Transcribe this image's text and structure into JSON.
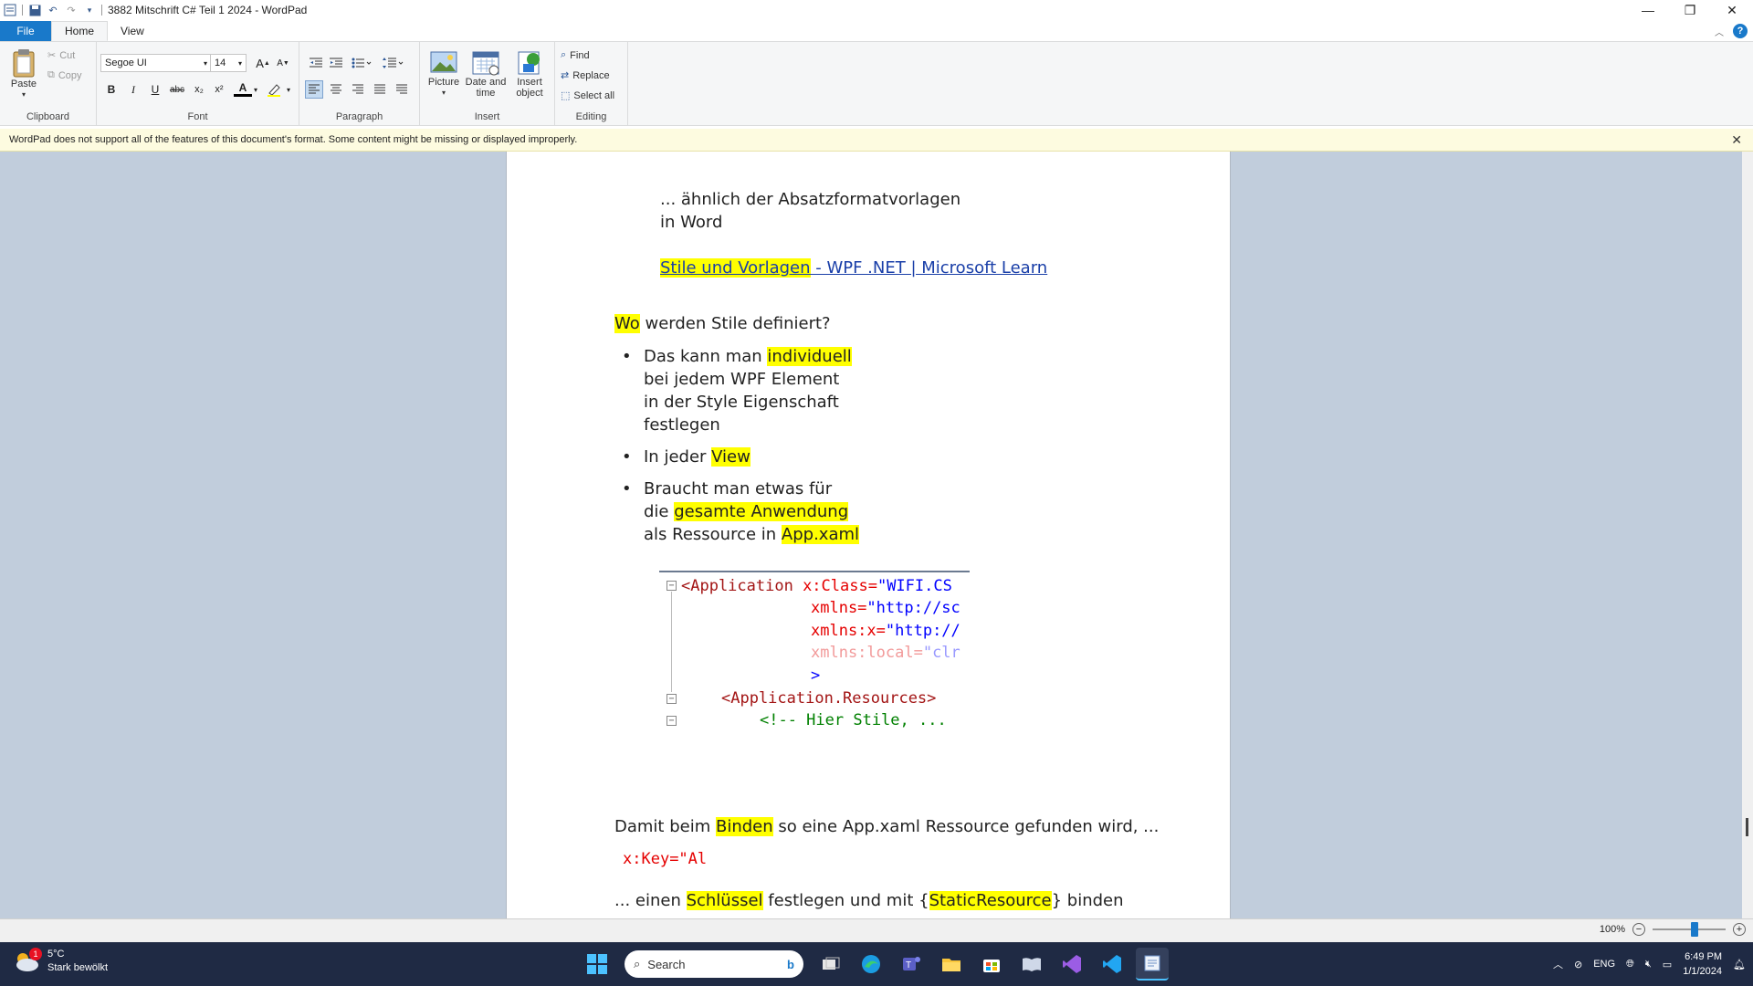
{
  "window": {
    "title": "3882 Mitschrift C# Teil 1 2024 - WordPad"
  },
  "tabs": [
    {
      "label": "File"
    },
    {
      "label": "Home"
    },
    {
      "label": "View"
    }
  ],
  "ribbon": {
    "clipboard": {
      "label": "Clipboard",
      "paste": "Paste",
      "cut": "Cut",
      "copy": "Copy"
    },
    "font": {
      "label": "Font",
      "family": "Segoe UI",
      "size": "14",
      "bold": "B",
      "italic": "I",
      "underline": "U",
      "strike": "abc",
      "subscript": "x₂",
      "superscript": "x²",
      "color_letter": "A",
      "grow": "A",
      "shrink": "A"
    },
    "paragraph": {
      "label": "Paragraph"
    },
    "insert": {
      "label": "Insert",
      "picture": "Picture",
      "datetime_line1": "Date and",
      "datetime_line2": "time",
      "object_line1": "Insert",
      "object_line2": "object"
    },
    "editing": {
      "label": "Editing",
      "find": "Find",
      "replace": "Replace",
      "select_all": "Select all"
    }
  },
  "infobar": {
    "message": "WordPad does not support all of the features of this document's format. Some content might be missing or displayed improperly."
  },
  "document": {
    "line1": "... ähnlich der Absatzformatvorlagen",
    "line2": "in Word",
    "link_hl": "Stile und Vorlagen",
    "link_rest": " - WPF .NET | Microsoft Learn",
    "q_hl": "Wo",
    "q_rest": " werden Stile definiert?",
    "b1_pre": "Das kann man ",
    "b1_hl": "individuell",
    "b1_l2": "bei jedem WPF Element",
    "b1_l3": "in der Style Eigenschaft",
    "b1_l4": "festlegen",
    "b2_pre": "In jeder ",
    "b2_hl": "View",
    "b3_l1": "Braucht man etwas für",
    "b3_pre2": "die ",
    "b3_hl2": "gesamte Anwendung",
    "b3_pre3": "als Ressource in ",
    "b3_hl3": "App.xaml",
    "p2_pre": "Damit beim ",
    "p2_hl": "Binden",
    "p2_rest": " so eine App.xaml Ressource gefunden wird, ...",
    "key_x": "x",
    "key_rest": ":Key=\"Al",
    "p3_pre": "... einen ",
    "p3_hl1": "Schlüssel",
    "p3_mid": " festlegen und mit {",
    "p3_hl2": "StaticResource",
    "p3_end": "} binden"
  },
  "code": {
    "l1_tag": "<Application",
    "l1_attr": " x:Class=",
    "l1_val": "\"WIFI.CS",
    "l2_attr": "xmlns=",
    "l2_val": "\"http://sc",
    "l3_attr": "xmlns:x=",
    "l3_val": "\"http://",
    "l4_attr": "xmlns:local=",
    "l4_val": "\"clr",
    "l5": ">",
    "l6": "<Application.Resources>",
    "l7": "<!-- Hier Stile, ..."
  },
  "statusbar": {
    "zoom": "100%"
  },
  "taskbar": {
    "temp": "5°C",
    "weather": "Stark bewölkt",
    "badge": "1",
    "search_placeholder": "Search",
    "lang": "ENG",
    "time": "6:49 PM",
    "date": "1/1/2024"
  }
}
